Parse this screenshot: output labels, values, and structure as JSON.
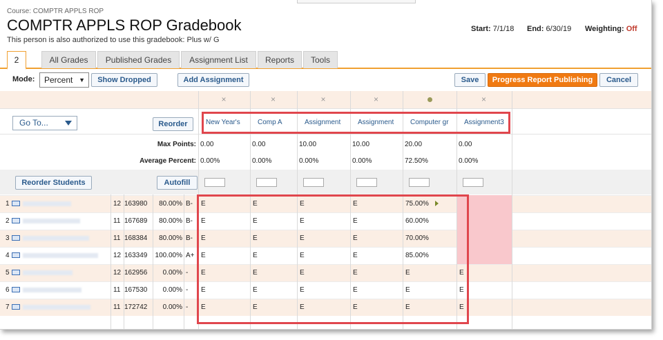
{
  "header": {
    "course": "Course: COMPTR APPLS ROP",
    "title": "COMPTR APPLS ROP Gradebook",
    "authorized": "This person is also authorized to use this gradebook: Plus w/ G",
    "start_label": "Start:",
    "start_value": "7/1/18",
    "end_label": "End:",
    "end_value": "6/30/19",
    "weighting_label": "Weighting:",
    "weighting_value": "Off"
  },
  "tabs": [
    "2",
    "All Grades",
    "Published Grades",
    "Assignment List",
    "Reports",
    "Tools"
  ],
  "toolbar": {
    "mode_label": "Mode:",
    "mode_value": "Percent",
    "show_dropped": "Show Dropped",
    "add_assignment": "Add Assignment",
    "save": "Save",
    "progress_report": "Progress Report Publishing",
    "cancel": "Cancel"
  },
  "controls": {
    "goto": "Go To...",
    "reorder": "Reorder",
    "reorder_students": "Reorder Students",
    "autofill": "Autofill",
    "max_points_label": "Max Points:",
    "avg_percent_label": "Average Percent:"
  },
  "assignments": [
    {
      "name": "New Year's",
      "max": "0.00",
      "avg": "0.00%",
      "status": "x"
    },
    {
      "name": "Comp A",
      "max": "0.00",
      "avg": "0.00%",
      "status": "x"
    },
    {
      "name": "Assignment",
      "max": "10.00",
      "avg": "0.00%",
      "status": "x"
    },
    {
      "name": "Assignment",
      "max": "10.00",
      "avg": "0.00%",
      "status": "x"
    },
    {
      "name": "Computer gr",
      "max": "20.00",
      "avg": "72.50%",
      "status": "dot"
    },
    {
      "name": "Assignment3",
      "max": "0.00",
      "avg": "0.00%",
      "status": "x"
    }
  ],
  "students": [
    {
      "num": "1",
      "grade": "12",
      "id": "163980",
      "pct": "80.00%",
      "letter": "B-",
      "scores": [
        "E",
        "E",
        "E",
        "E",
        "75.00%",
        ""
      ]
    },
    {
      "num": "2",
      "grade": "11",
      "id": "167689",
      "pct": "80.00%",
      "letter": "B-",
      "scores": [
        "E",
        "E",
        "E",
        "E",
        "60.00%",
        ""
      ]
    },
    {
      "num": "3",
      "grade": "11",
      "id": "168384",
      "pct": "80.00%",
      "letter": "B-",
      "scores": [
        "E",
        "E",
        "E",
        "E",
        "70.00%",
        ""
      ]
    },
    {
      "num": "4",
      "grade": "12",
      "id": "163349",
      "pct": "100.00%",
      "letter": "A+",
      "scores": [
        "E",
        "E",
        "E",
        "E",
        "85.00%",
        ""
      ]
    },
    {
      "num": "5",
      "grade": "12",
      "id": "162956",
      "pct": "0.00%",
      "letter": "-",
      "scores": [
        "E",
        "E",
        "E",
        "E",
        "E",
        "E"
      ]
    },
    {
      "num": "6",
      "grade": "11",
      "id": "167530",
      "pct": "0.00%",
      "letter": "-",
      "scores": [
        "E",
        "E",
        "E",
        "E",
        "E",
        "E"
      ]
    },
    {
      "num": "7",
      "grade": "11",
      "id": "172742",
      "pct": "0.00%",
      "letter": "-",
      "scores": [
        "E",
        "E",
        "E",
        "E",
        "E",
        "E"
      ]
    }
  ],
  "colors": {
    "accent": "#f07a12",
    "highlight": "#e0464d",
    "missing": "#f9c8cc"
  }
}
